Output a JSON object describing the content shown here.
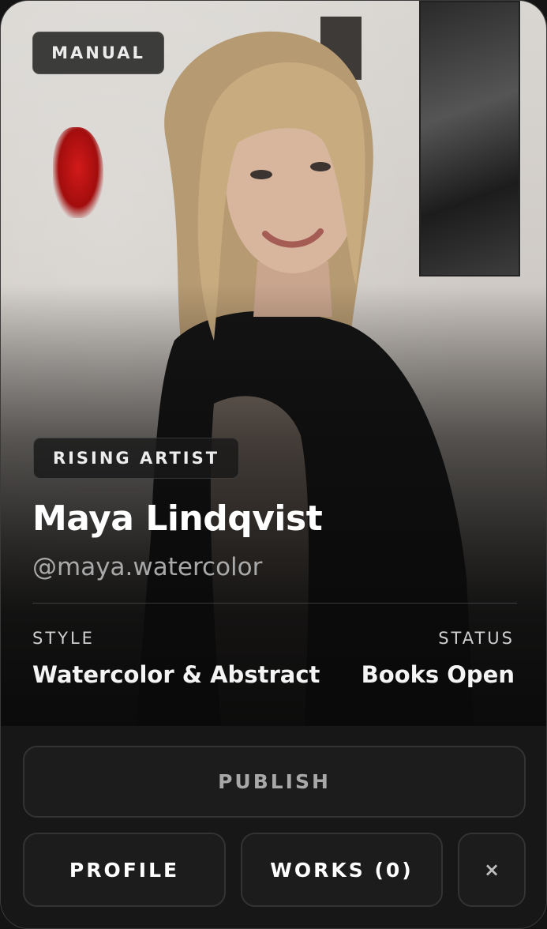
{
  "card": {
    "mode_badge": "MANUAL",
    "tier_badge": "RISING ARTIST",
    "name": "Maya Lindqvist",
    "handle": "@maya.watercolor",
    "style_label": "STYLE",
    "style_value": "Watercolor & Abstract",
    "status_label": "STATUS",
    "status_value": "Books Open"
  },
  "actions": {
    "publish_label": "PUBLISH",
    "profile_label": "PROFILE",
    "works_label": "WORKS (0)",
    "close_label": "×"
  },
  "icons": {
    "close": "close-icon"
  },
  "colors": {
    "background": "#161616",
    "publish_text": "#a8a8a8",
    "primary_text": "#ffffff",
    "handle_text": "#a9a9a9"
  }
}
